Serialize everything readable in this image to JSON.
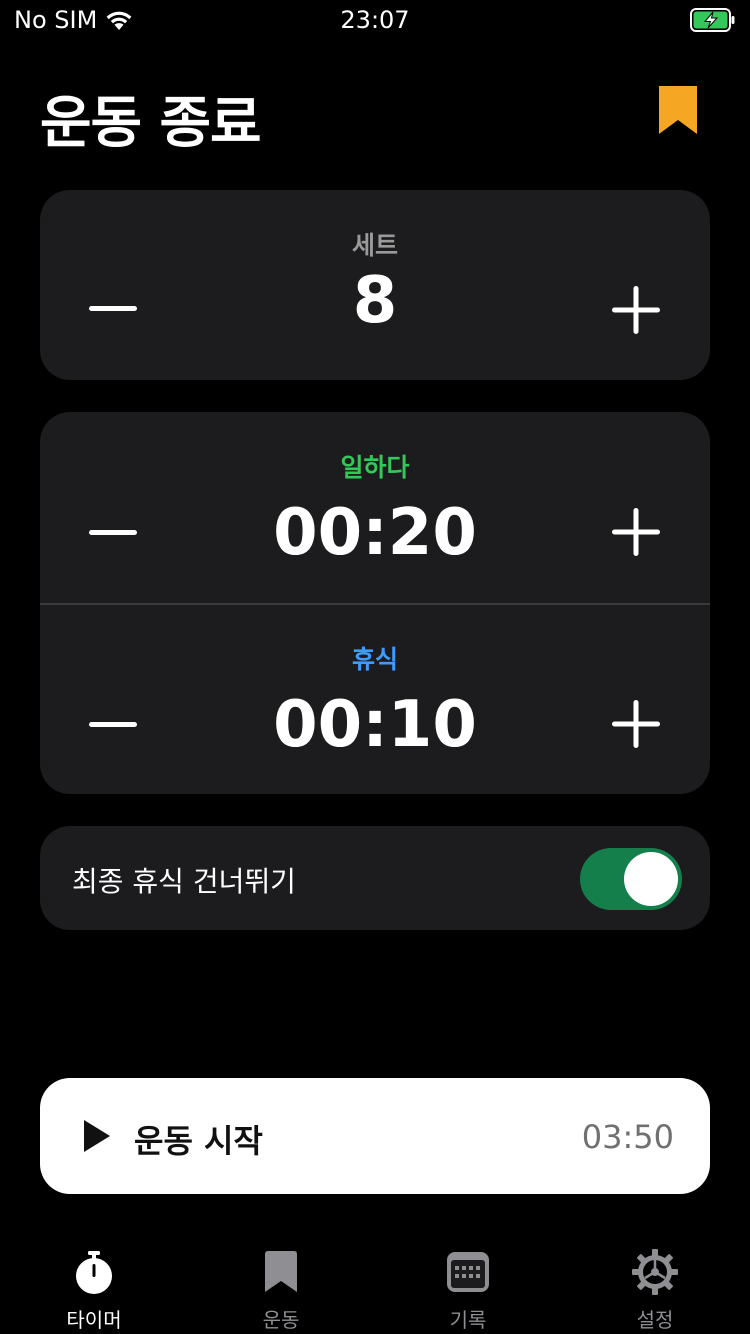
{
  "status_bar": {
    "carrier": "No SIM",
    "time": "23:07"
  },
  "header": {
    "title": "운동 종료",
    "bookmark_icon": "bookmark-icon",
    "bookmark_color": "#f5a623"
  },
  "sets": {
    "label": "세트",
    "value": "8",
    "label_color": "#9a9a9a"
  },
  "work": {
    "label": "일하다",
    "value": "00:20",
    "label_color": "#34c759"
  },
  "rest": {
    "label": "휴식",
    "value": "00:10",
    "label_color": "#3e9bff"
  },
  "skip_last_rest": {
    "label": "최종 휴식 건너뛰기",
    "enabled": true,
    "toggle_color": "#157f4b"
  },
  "start": {
    "label": "운동 시작",
    "total_time": "03:50",
    "icon": "play-icon"
  },
  "tabs": [
    {
      "label": "타이머",
      "icon": "stopwatch-icon",
      "active": true
    },
    {
      "label": "운동",
      "icon": "bookmark-icon",
      "active": false
    },
    {
      "label": "기록",
      "icon": "calendar-icon",
      "active": false
    },
    {
      "label": "설정",
      "icon": "gear-icon",
      "active": false
    }
  ],
  "colors": {
    "background": "#000000",
    "card": "#1c1c1e",
    "tab_active": "#ffffff",
    "tab_inactive": "#8e8e93",
    "battery": "#34c759"
  }
}
